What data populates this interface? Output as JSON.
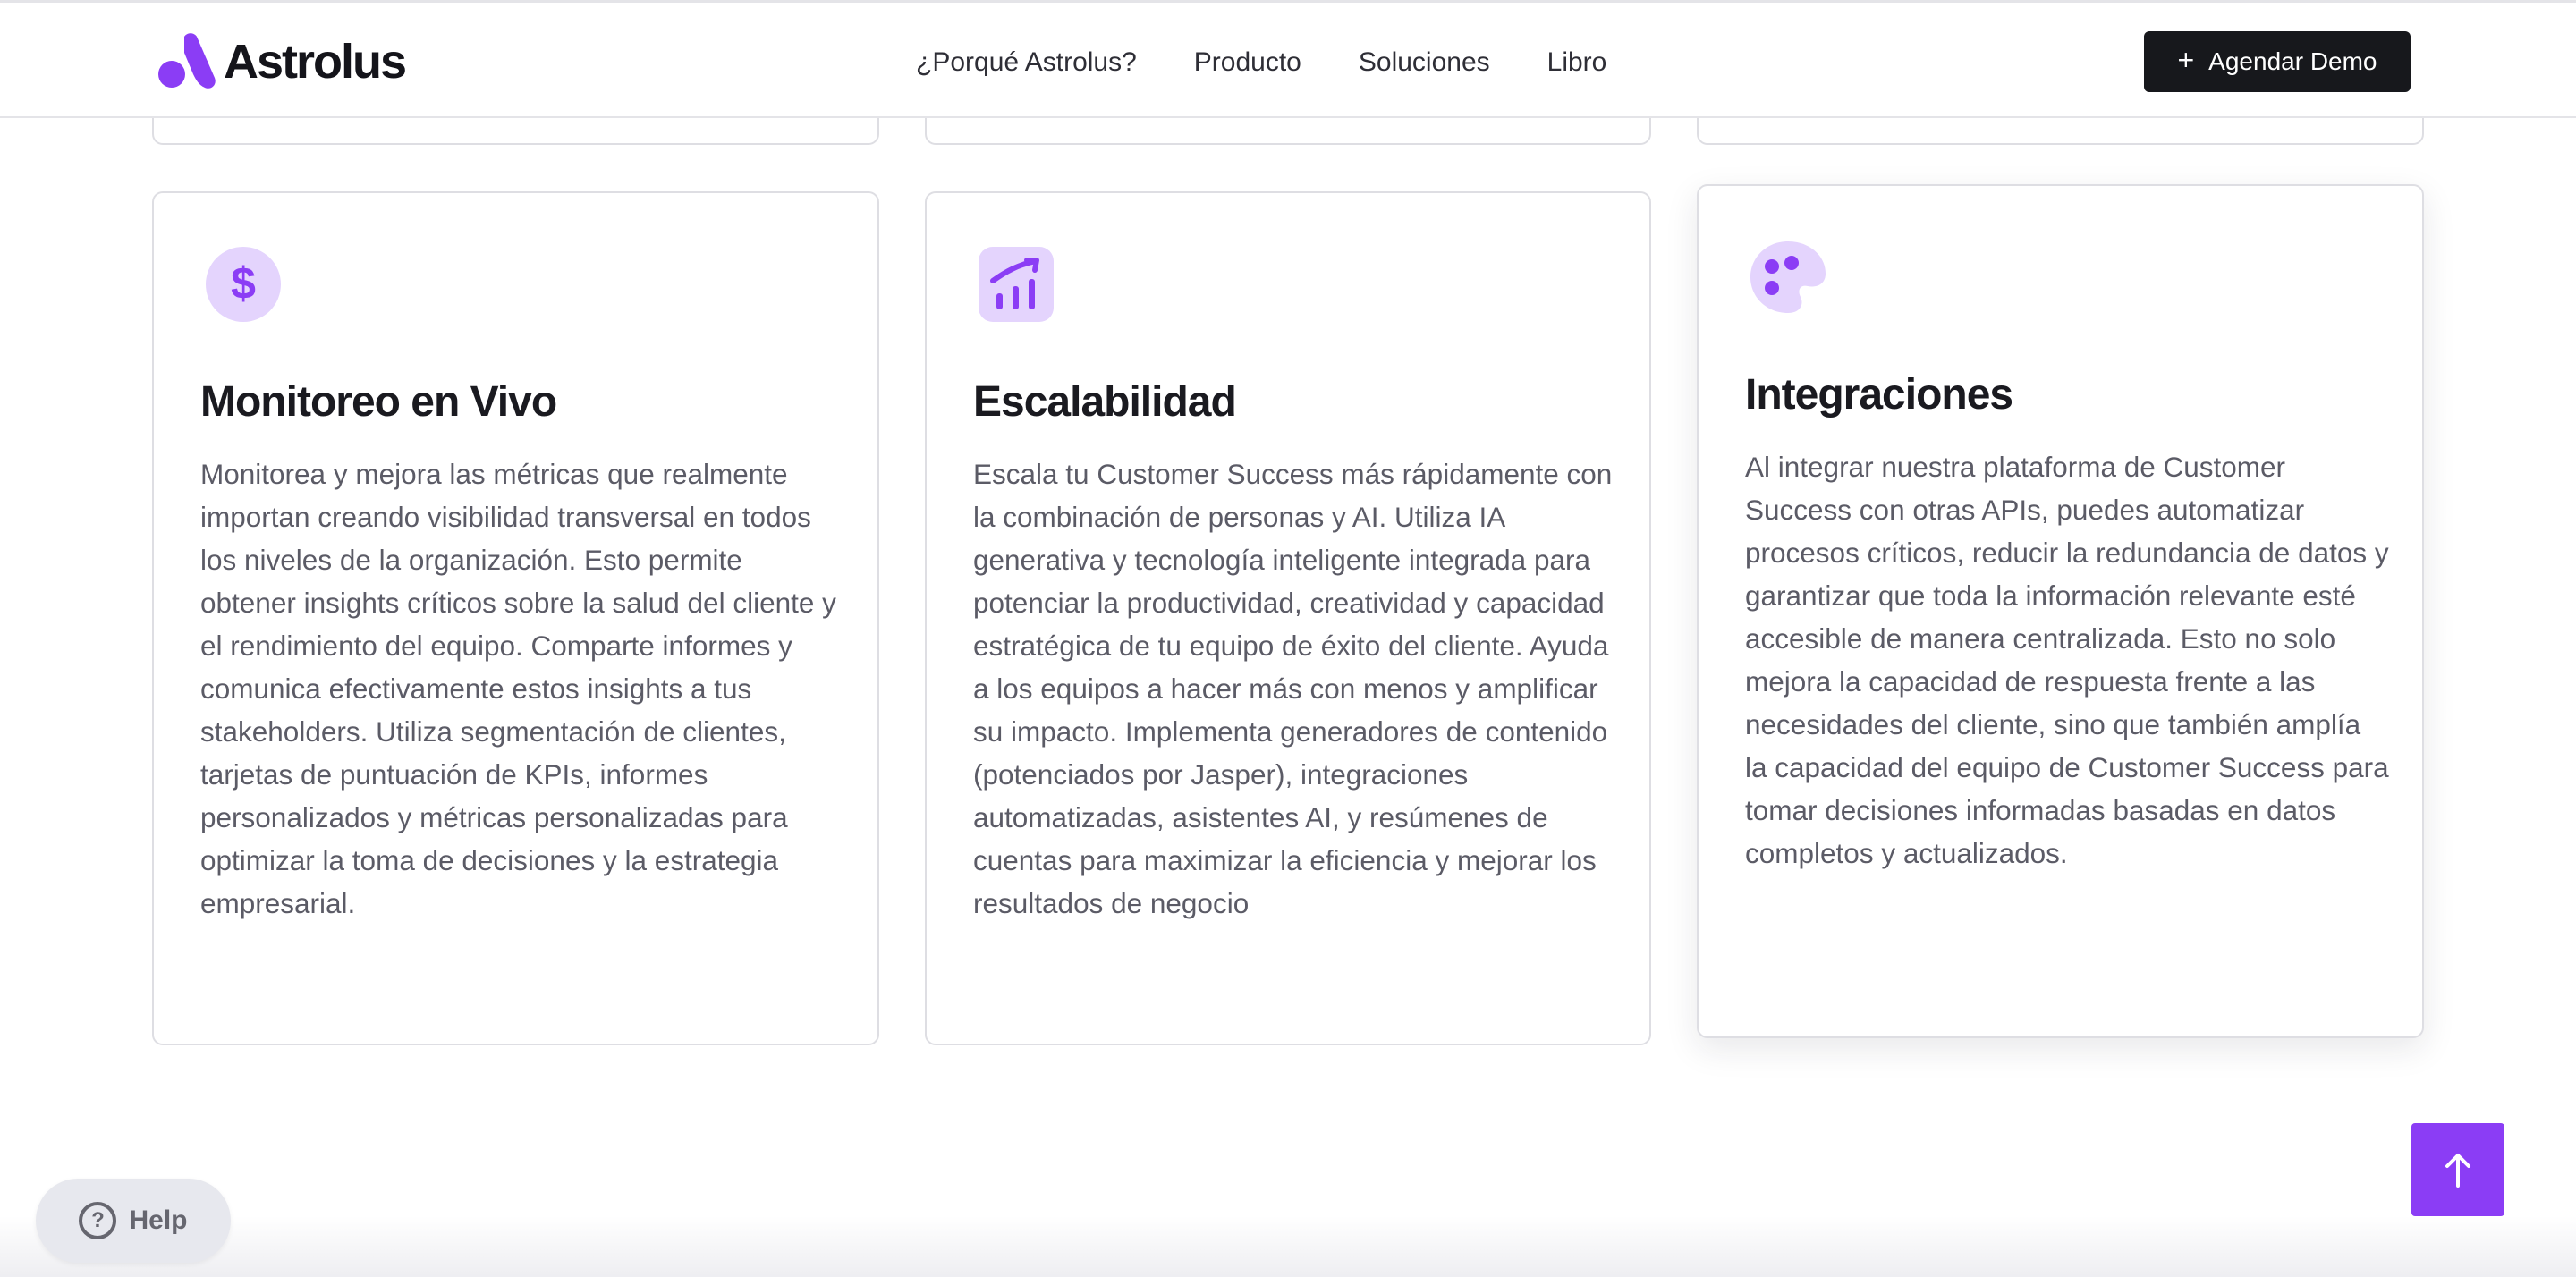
{
  "header": {
    "logo_text": "Astrolus",
    "nav": [
      {
        "label": "¿Porqué Astrolus?"
      },
      {
        "label": "Producto"
      },
      {
        "label": "Soluciones"
      },
      {
        "label": "Libro"
      }
    ],
    "cta_label": "Agendar Demo"
  },
  "features": [
    {
      "icon": "dollar-icon",
      "title": "Monitoreo en Vivo",
      "description": "Monitorea y mejora las métricas que realmente importan creando visibilidad transversal en todos los niveles de la organización. Esto permite obtener insights críticos sobre la salud del cliente y el rendimiento del equipo. Comparte informes y comunica efectivamente estos insights a tus stakeholders. Utiliza segmentación de clientes, tarjetas de puntuación de KPIs, informes personalizados y métricas personalizadas para optimizar la toma de decisiones y la estrategia empresarial."
    },
    {
      "icon": "growth-chart-icon",
      "title": "Escalabilidad",
      "description": "Escala tu Customer Success más rápidamente con la combinación de personas y AI. Utiliza IA generativa y tecnología inteligente integrada para potenciar la productividad, creatividad y capacidad estratégica de tu equipo de éxito del cliente. Ayuda a los equipos a hacer más con menos y amplificar su impacto. Implementa generadores de contenido (potenciados por Jasper), integraciones automatizadas, asistentes AI, y resúmenes de cuentas para maximizar la eficiencia y mejorar los resultados de negocio"
    },
    {
      "icon": "palette-icon",
      "title": "Integraciones",
      "description": "Al integrar nuestra plataforma de Customer Success con otras APIs, puedes automatizar procesos críticos, reducir la redundancia de datos y garantizar que toda la información relevante esté accesible de manera centralizada. Esto no solo mejora la capacidad de respuesta frente a las necesidades del cliente, sino que también amplía la capacidad del equipo de Customer Success para tomar decisiones informadas basadas en datos completos y actualizados."
    }
  ],
  "help": {
    "label": "Help",
    "icon": "question-icon"
  },
  "scroll_top": {
    "icon": "arrow-up-icon"
  },
  "colors": {
    "accent": "#8b3df5",
    "accent_light": "#e4d4fd",
    "button_dark": "#17181c",
    "heading": "#1a1a20",
    "body_text": "#5b5b66",
    "border": "#dedee3"
  }
}
